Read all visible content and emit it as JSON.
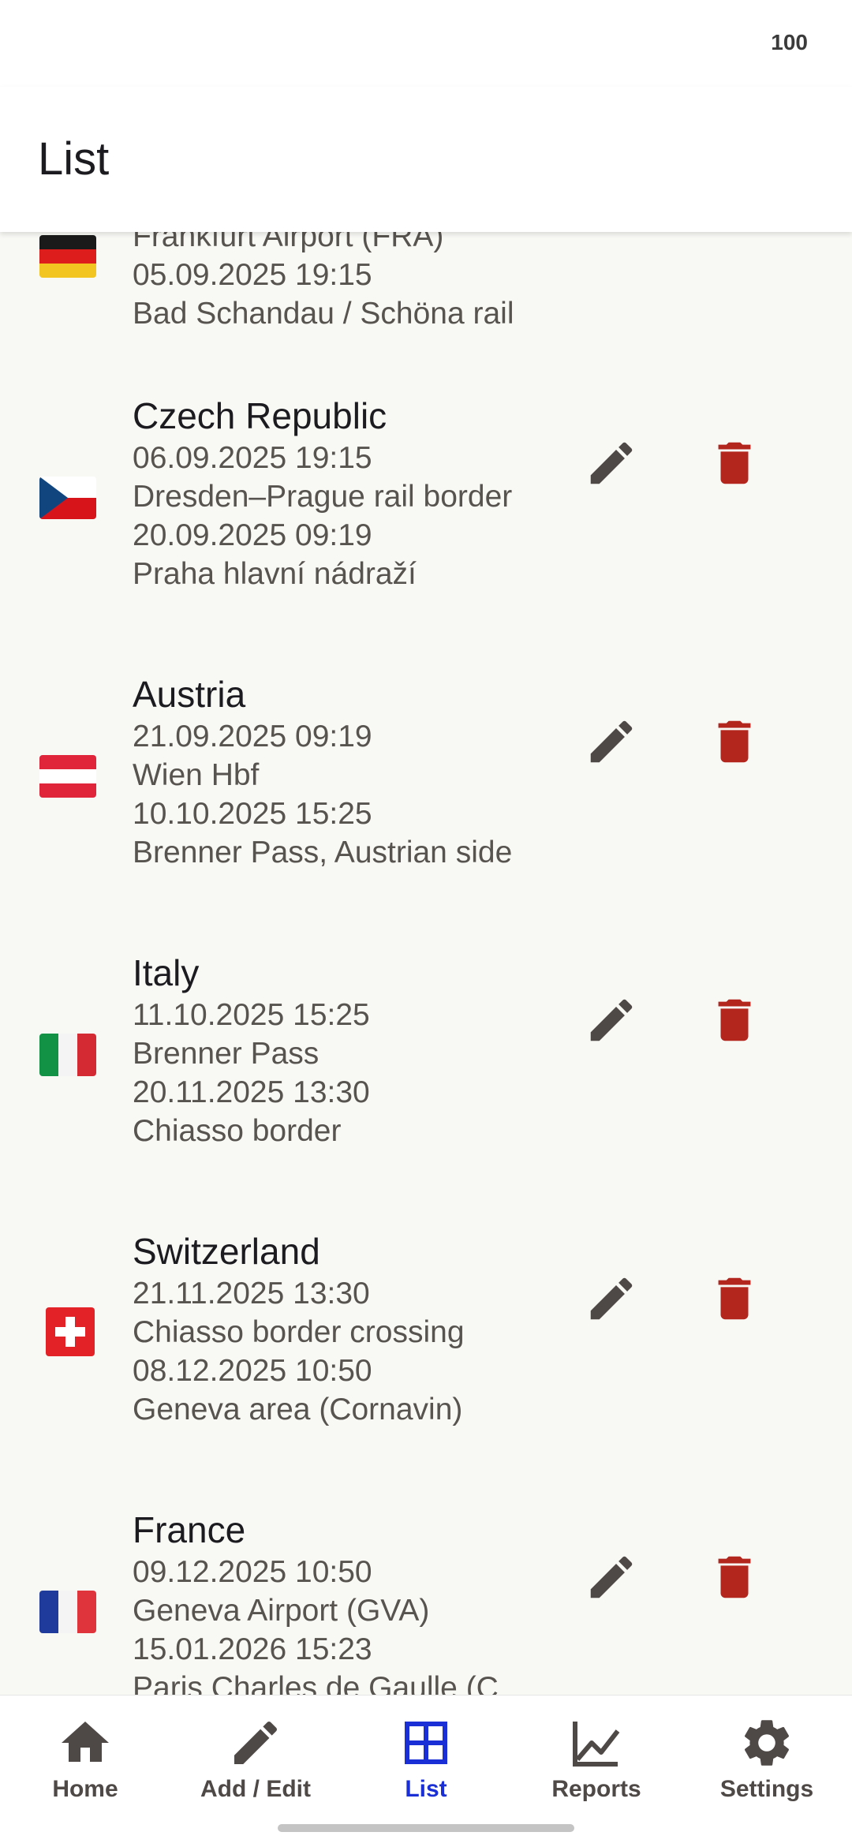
{
  "status_bar": {
    "battery": "100"
  },
  "app_bar": {
    "title": "List"
  },
  "entries": [
    {
      "country": "",
      "partial_line": "Frankfurt Airport (FRA)",
      "exit_time": "05.09.2025 19:15",
      "exit_place": "Bad Schandau / Schöna rail"
    },
    {
      "country": "Czech Republic",
      "entry_time": "06.09.2025 19:15",
      "entry_place": "Dresden–Prague rail border",
      "exit_time": "20.09.2025 09:19",
      "exit_place": "Praha hlavní nádraží"
    },
    {
      "country": "Austria",
      "entry_time": "21.09.2025 09:19",
      "entry_place": "Wien Hbf",
      "exit_time": "10.10.2025 15:25",
      "exit_place": "Brenner Pass, Austrian side"
    },
    {
      "country": "Italy",
      "entry_time": "11.10.2025 15:25",
      "entry_place": "Brenner Pass",
      "exit_time": "20.11.2025 13:30",
      "exit_place": "Chiasso border"
    },
    {
      "country": "Switzerland",
      "entry_time": "21.11.2025 13:30",
      "entry_place": "Chiasso border crossing",
      "exit_time": "08.12.2025 10:50",
      "exit_place": "Geneva area (Cornavin)"
    },
    {
      "country": "France",
      "entry_time": "09.12.2025 10:50",
      "entry_place": "Geneva Airport (GVA)",
      "exit_time": "15.01.2026 15:23",
      "exit_place": "Paris Charles de Gaulle (C"
    }
  ],
  "nav": {
    "items": [
      {
        "label": "Home",
        "icon": "home-icon"
      },
      {
        "label": "Add / Edit",
        "icon": "pencil-icon"
      },
      {
        "label": "List",
        "icon": "table-icon"
      },
      {
        "label": "Reports",
        "icon": "chart-line-icon"
      },
      {
        "label": "Settings",
        "icon": "gear-icon"
      }
    ],
    "active": "List"
  },
  "colors": {
    "accent": "#1b2fd6",
    "delete": "#b3261e",
    "icon": "#4e4846"
  }
}
